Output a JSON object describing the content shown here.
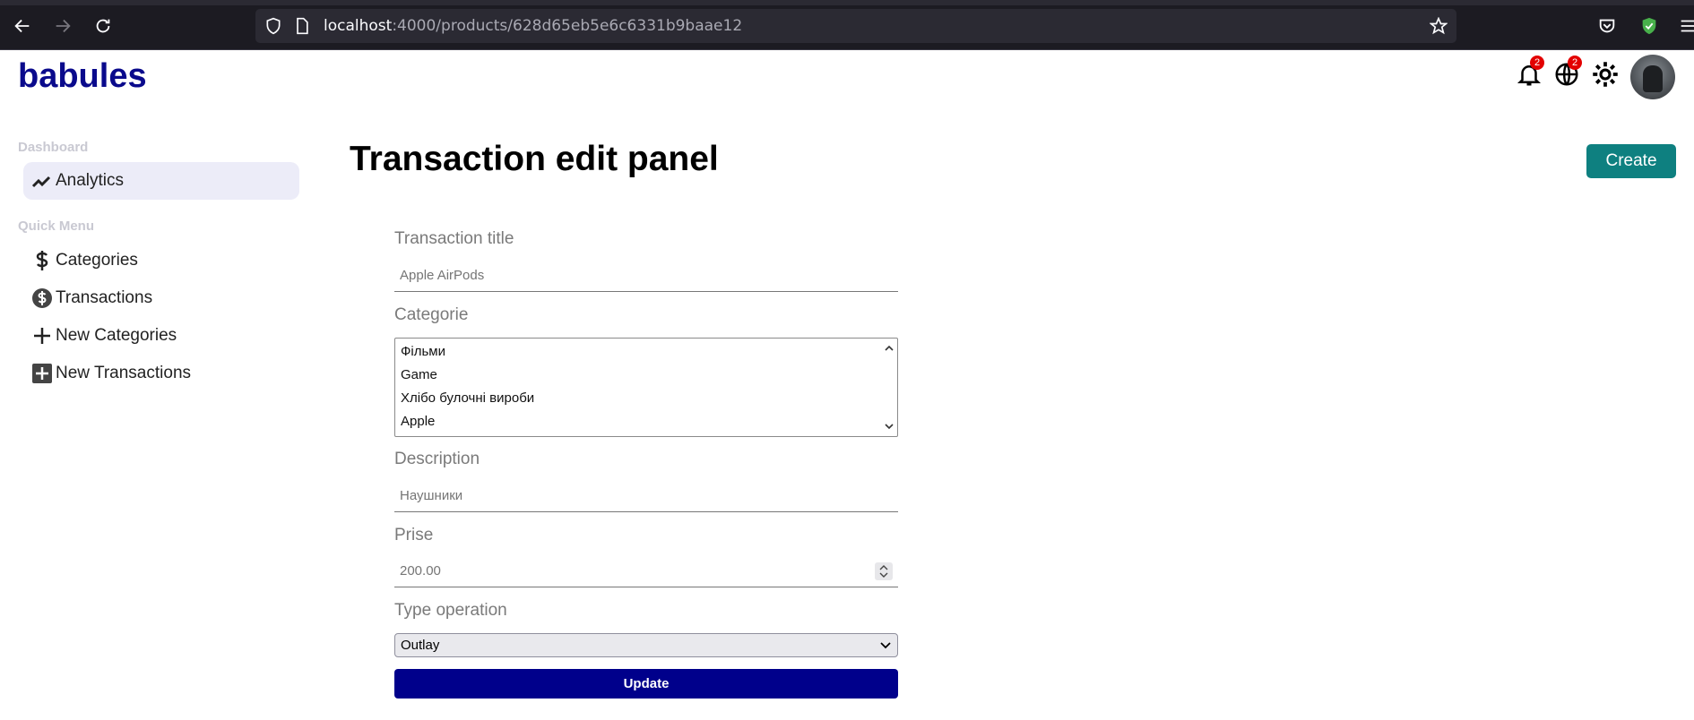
{
  "browser": {
    "url_host": "localhost",
    "url_path": ":4000/products/628d65eb5e6c6331b9baae12"
  },
  "app": {
    "brand": "babules",
    "notifications_count": "2",
    "language_count": "2"
  },
  "sidebar": {
    "sections": [
      {
        "title": "Dashboard",
        "items": [
          {
            "label": "Analytics",
            "icon": "trending-up-icon",
            "active": true
          }
        ]
      },
      {
        "title": "Quick Menu",
        "items": [
          {
            "label": "Categories",
            "icon": "dollar-icon"
          },
          {
            "label": "Transactions",
            "icon": "dollar-circle-icon"
          },
          {
            "label": "New Categories",
            "icon": "plus-icon"
          },
          {
            "label": "New Transactions",
            "icon": "plus-box-icon"
          }
        ]
      }
    ]
  },
  "main": {
    "title": "Transaction edit panel",
    "create_label": "Create",
    "form": {
      "title_label": "Transaction title",
      "title_placeholder": "Apple AirPods",
      "category_label": "Categorie",
      "category_options": [
        "Фільми",
        "Game",
        "Хлібо булочні вироби",
        "Apple"
      ],
      "description_label": "Description",
      "description_placeholder": "Наушники",
      "price_label": "Prise",
      "price_placeholder": "200.00",
      "type_label": "Type operation",
      "type_value": "Outlay",
      "update_label": "Update"
    }
  },
  "colors": {
    "brand": "#0a0a8c",
    "create_button": "#0e8080",
    "update_button": "#00008b",
    "active_sidebar": "#ececf8",
    "badge": "#e30000"
  }
}
